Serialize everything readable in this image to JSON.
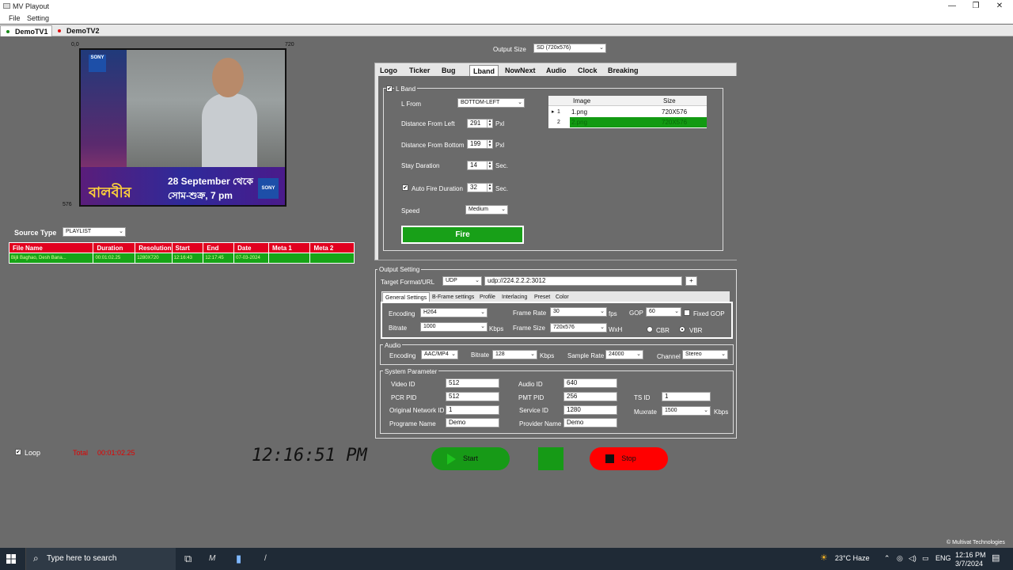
{
  "window": {
    "title": "MV Playout",
    "minimize": "—",
    "maximize": "❐",
    "close": "✕"
  },
  "menu": {
    "file": "File",
    "setting": "Setting"
  },
  "channels": [
    {
      "label": "DemoTV1",
      "dot_color": "#1a8a1a"
    },
    {
      "label": "DemoTV2",
      "dot_color": "#e01010"
    }
  ],
  "preview": {
    "coord_top_left": "0,0",
    "coord_width": "720",
    "coord_height": "576",
    "logo_text": "SONY",
    "banner_line1": "28 September থেকে",
    "banner_line2": "সোম-শুক্র, 7 pm",
    "banner_title": "বালবীর"
  },
  "source": {
    "label": "Source Type",
    "value": "PLAYLIST"
  },
  "playlist": {
    "columns": [
      "File Name",
      "Duration",
      "Resolution",
      "Start",
      "End",
      "Date",
      "Meta 1",
      "Meta 2"
    ],
    "rows": [
      [
        "Bijli Baghao, Desh Bana...",
        "00:01:02.25",
        "1280X720",
        "12:16:43",
        "12:17:45",
        "07-03-2024",
        "",
        ""
      ]
    ]
  },
  "footer": {
    "loop_label": "Loop",
    "loop_checked": "✔",
    "total_label": "Total",
    "total_value": "00:01:02.25",
    "clock": "12:16:51 PM",
    "credit": "© Multivat Technologies"
  },
  "output_size": {
    "label": "Output Size",
    "value": "SD (720x576)"
  },
  "overlay_tabs": [
    "Logo",
    "Ticker",
    "Bug",
    "Lband",
    "NowNext",
    "Audio",
    "Clock",
    "Breaking"
  ],
  "lband": {
    "enable_label": "L Band",
    "enable_checked": "✔",
    "from_label": "L From",
    "from_value": "BOTTOM-LEFT",
    "dist_left_label": "Distance From Left",
    "dist_left_value": "291",
    "dist_bottom_label": "Distance From Bottom",
    "dist_bottom_value": "199",
    "px_unit": "Pxl",
    "stay_label": "Stay Daration",
    "stay_value": "14",
    "sec_unit": "Sec.",
    "autofire_label": "Auto Fire Duration",
    "autofire_value": "32",
    "autofire_checked": "✔",
    "speed_label": "Speed",
    "speed_value": "Medium",
    "fire_label": "Fire",
    "grid_headers": [
      "Image",
      "Size"
    ],
    "grid_rows": [
      {
        "idx": "1",
        "image": "1.png",
        "size": "720X576",
        "marker": "▸"
      },
      {
        "idx": "2",
        "image": "2.png",
        "size": "720X576",
        "marker": ""
      }
    ]
  },
  "output_setting": {
    "legend": "Output Setting",
    "target_label": "Target Format/URL",
    "target_format": "UDP",
    "target_url": "udp://224.2.2.2:3012",
    "add_label": "+",
    "tabs": [
      "General Settings",
      "B-Frame settings",
      "Profile",
      "Interlacing",
      "Preset",
      "Color"
    ],
    "encoding_label": "Encoding",
    "encoding_value": "H264",
    "bitrate_label": "Bitrate",
    "bitrate_value": "1000",
    "kbps": "Kbps",
    "framerate_label": "Frame Rate",
    "framerate_value": "30",
    "fps": "fps",
    "framesize_label": "Frame Size",
    "framesize_value": "720x576",
    "wxh": "WxH",
    "gop_label": "GOP",
    "gop_value": "60",
    "fixed_gop_label": "Fixed GOP",
    "cbr_label": "CBR",
    "vbr_label": "VBR"
  },
  "audio": {
    "legend": "Audio",
    "encoding_label": "Encoding",
    "encoding_value": "AAC/MP4",
    "bitrate_label": "Bitrate",
    "bitrate_value": "128",
    "kbps": "Kbps",
    "samplerate_label": "Sample Rate",
    "samplerate_value": "24000",
    "channel_label": "Channel",
    "channel_value": "Stereo"
  },
  "system": {
    "legend": "System Parameter",
    "video_id_label": "Video ID",
    "video_id": "512",
    "pcr_pid_label": "PCR PID",
    "pcr_pid": "512",
    "onid_label": "Original Network ID",
    "onid": "1",
    "prog_name_label": "Programe Name",
    "prog_name": "Demo",
    "audio_id_label": "Audio ID",
    "audio_id": "640",
    "pmt_pid_label": "PMT PID",
    "pmt_pid": "256",
    "service_id_label": "Service ID",
    "service_id": "1280",
    "provider_label": "Provider Name",
    "provider": "Demo",
    "ts_id_label": "TS ID",
    "ts_id": "1",
    "muxrate_label": "Muxrate",
    "muxrate": "1500",
    "kbps": "Kbps"
  },
  "controls": {
    "start_label": "Start",
    "stop_label": "Stop"
  },
  "taskbar": {
    "search_placeholder": "Type here to search",
    "weather": "23°C  Haze",
    "lang": "ENG",
    "time": "12:16 PM",
    "date": "3/7/2024"
  }
}
